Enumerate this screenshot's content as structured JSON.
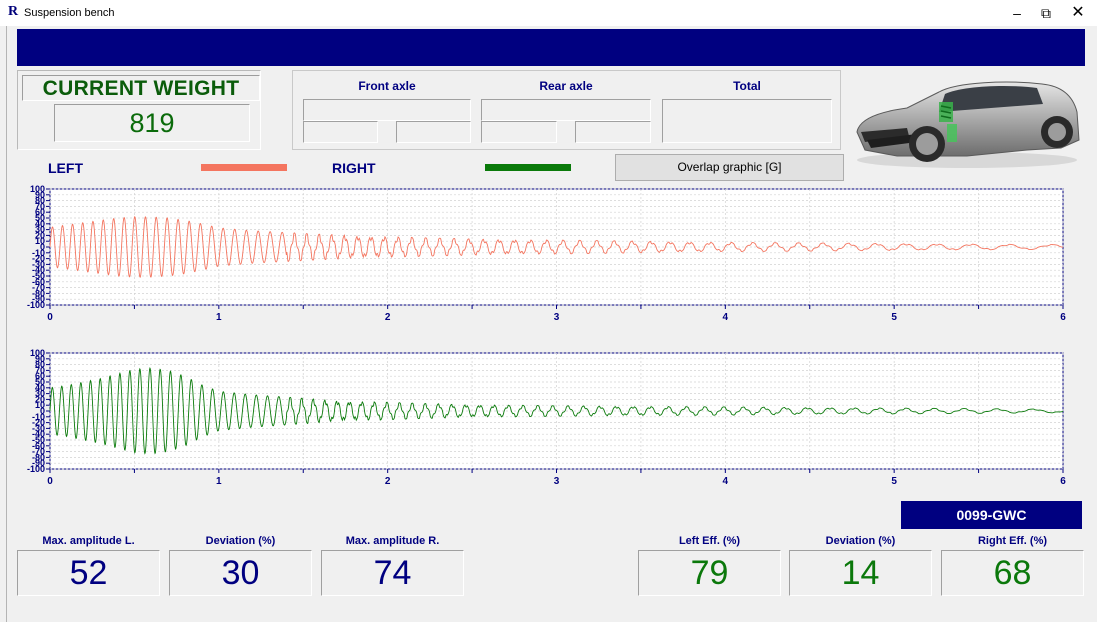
{
  "window": {
    "logo": "R",
    "title": "Suspension bench",
    "minimize": "–",
    "restore": "⧉",
    "close": "✕"
  },
  "weight": {
    "title": "CURRENT WEIGHT",
    "value": "819"
  },
  "axles": {
    "front": "Front axle",
    "rear": "Rear axle",
    "total": "Total"
  },
  "legend": {
    "left": "LEFT",
    "right": "RIGHT",
    "left_color": "#f4755f",
    "right_color": "#0a7a0a"
  },
  "overlap_button": "Overlap graphic [G]",
  "plate": "0099-GWC",
  "metrics": {
    "max_amp_left_label": "Max. amplitude L.",
    "max_amp_left": "52",
    "deviation_label": "Deviation (%)",
    "deviation": "30",
    "max_amp_right_label": "Max. amplitude R.",
    "max_amp_right": "74",
    "left_eff_label": "Left Eff. (%)",
    "left_eff": "79",
    "eff_deviation_label": "Deviation (%)",
    "eff_deviation": "14",
    "right_eff_label": "Right Eff. (%)",
    "right_eff": "68"
  },
  "chart_data": [
    {
      "type": "line",
      "series_color": "#f4755f",
      "xlim": [
        0,
        6
      ],
      "ylim": [
        -100,
        100
      ],
      "x_ticks": [
        "0",
        "1",
        "2",
        "3",
        "4",
        "5",
        "6"
      ],
      "y_ticks": [
        "100",
        "90",
        "80",
        "70",
        "60",
        "50",
        "40",
        "30",
        "20",
        "10",
        "0",
        "-10",
        "-20",
        "-30",
        "-40",
        "-50",
        "-60",
        "-70",
        "-80",
        "-90",
        "-100"
      ],
      "x": [
        0.0,
        0.1,
        0.2,
        0.3,
        0.4,
        0.5,
        0.6,
        0.7,
        0.8,
        0.9,
        1.0,
        1.2,
        1.4,
        1.6,
        1.8,
        2.0,
        2.2,
        2.5,
        3.0,
        3.5,
        4.0,
        4.5,
        5.0,
        5.5,
        6.0
      ],
      "envelope": [
        34,
        38,
        42,
        46,
        50,
        52,
        52,
        50,
        46,
        40,
        33,
        28,
        25,
        22,
        20,
        18,
        16,
        14,
        12,
        10,
        8,
        7,
        6,
        5,
        4
      ]
    },
    {
      "type": "line",
      "series_color": "#0a7a0a",
      "xlim": [
        0,
        6
      ],
      "ylim": [
        -100,
        100
      ],
      "x_ticks": [
        "0",
        "1",
        "2",
        "3",
        "4",
        "5",
        "6"
      ],
      "y_ticks": [
        "100",
        "90",
        "80",
        "70",
        "60",
        "50",
        "40",
        "30",
        "20",
        "10",
        "0",
        "-10",
        "-20",
        "-30",
        "-40",
        "-50",
        "-60",
        "-70",
        "-80",
        "-90",
        "-100"
      ],
      "x": [
        0.0,
        0.1,
        0.2,
        0.3,
        0.4,
        0.5,
        0.6,
        0.7,
        0.8,
        0.9,
        1.0,
        1.2,
        1.4,
        1.6,
        1.8,
        2.0,
        2.2,
        2.5,
        3.0,
        3.5,
        4.0,
        4.5,
        5.0,
        5.5,
        6.0
      ],
      "envelope": [
        40,
        44,
        50,
        56,
        64,
        72,
        74,
        70,
        60,
        45,
        34,
        28,
        24,
        20,
        17,
        15,
        13,
        11,
        9,
        8,
        7,
        6,
        5,
        4,
        3
      ]
    }
  ]
}
